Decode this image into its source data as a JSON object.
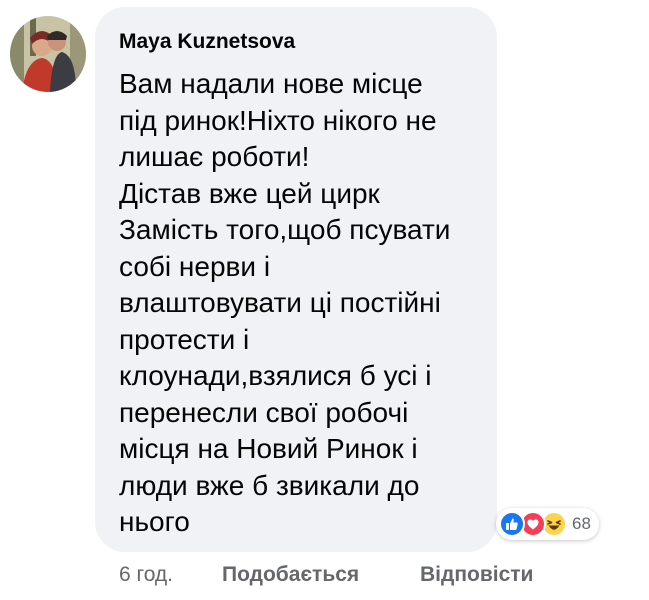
{
  "comment": {
    "author": "Maya Kuznetsova",
    "text": "Вам надали нове місце\nпід ринок!Ніхто нікого не\nлишає роботи!\nДістав вже цей цирк\nЗамість того,щоб псувати\nсобі нерви і\nвлаштовувати ці постійні\nпротести і\nклоунади,взялися б усі і\nперенесли свої робочі\nмісця на Новий Ринок і\nлюди вже б звикали до\nнього",
    "reactions": {
      "icons": [
        "like-icon",
        "love-icon",
        "haha-icon"
      ],
      "count": "68"
    },
    "actions": {
      "time": "6 год.",
      "like_label": "Подобається",
      "reply_label": "Відповісти"
    }
  },
  "colors": {
    "bubble": "#f0f2f5",
    "secondary_text": "#65676b",
    "like": "#1877f2",
    "love": "#f33e58",
    "haha": "#fcd34d"
  }
}
